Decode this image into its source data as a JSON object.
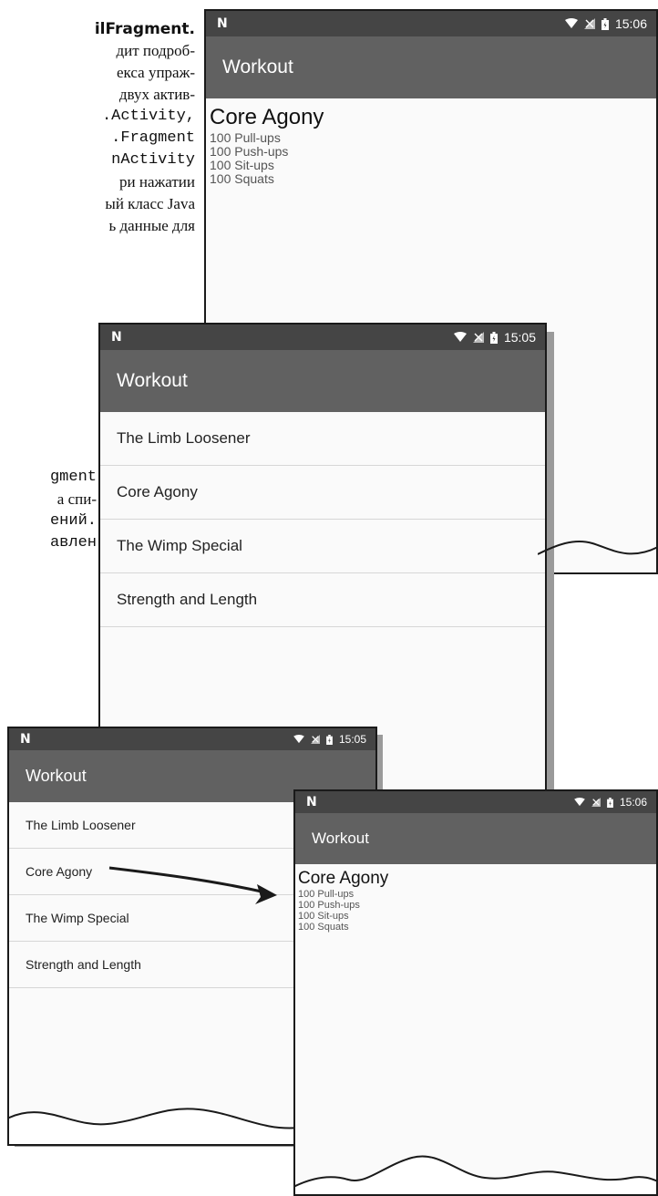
{
  "book_text_top": [
    "ilFragment.",
    "дит подроб-",
    "екса упраж-",
    "двух актив-",
    ".Activity,",
    ".Fragment",
    "nActivity",
    "ри нажатии",
    "ый класс Java",
    "ь данные для"
  ],
  "book_text_mid": [
    "gment",
    "а спи-",
    "ений.",
    "авлен"
  ],
  "screens": {
    "detail_top": {
      "time": "15:06",
      "title": "Workout",
      "workout_name": "Core Agony",
      "exercises": [
        "100 Pull-ups",
        "100 Push-ups",
        "100 Sit-ups",
        "100 Squats"
      ]
    },
    "list_mid": {
      "time": "15:05",
      "title": "Workout",
      "items": [
        "The Limb Loosener",
        "Core Agony",
        "The Wimp Special",
        "Strength and Length"
      ]
    },
    "list_bottom": {
      "time": "15:05",
      "title": "Workout",
      "items": [
        "The Limb Loosener",
        "Core Agony",
        "The Wimp Special",
        "Strength and Length"
      ]
    },
    "detail_bottom": {
      "time": "15:06",
      "title": "Workout",
      "workout_name": "Core Agony",
      "exercises": [
        "100 Pull-ups",
        "100 Push-ups",
        "100 Sit-ups",
        "100 Squats"
      ]
    }
  },
  "icons": [
    "n-icon",
    "wifi-icon",
    "signal-icon",
    "battery-icon",
    "arrow-icon"
  ],
  "colors": {
    "statusbar": "#454545",
    "appbar": "#616161",
    "screen_bg": "#fafafa",
    "divider": "#d6d6d6"
  }
}
